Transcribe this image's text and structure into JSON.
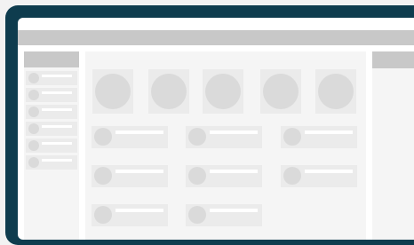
{
  "colors": {
    "device_frame": "#0e3c4e",
    "screen_background": "#ffffff",
    "bar": "#c8c8c8",
    "panel": "#f5f5f5",
    "placeholder": "#ebebeb",
    "placeholder_shape": "#dadada"
  },
  "sidebar": {
    "items": [
      {
        "icon": "circle-placeholder-icon"
      },
      {
        "icon": "circle-placeholder-icon"
      },
      {
        "icon": "circle-placeholder-icon"
      },
      {
        "icon": "circle-placeholder-icon"
      },
      {
        "icon": "circle-placeholder-icon"
      },
      {
        "icon": "circle-placeholder-icon"
      }
    ]
  },
  "main": {
    "avatars": [
      {
        "icon": "avatar-placeholder-icon"
      },
      {
        "icon": "avatar-placeholder-icon"
      },
      {
        "icon": "avatar-placeholder-icon"
      },
      {
        "icon": "avatar-placeholder-icon"
      },
      {
        "icon": "avatar-placeholder-icon"
      }
    ],
    "cards": [
      {
        "icon": "circle-placeholder-icon"
      },
      {
        "icon": "circle-placeholder-icon"
      },
      {
        "icon": "circle-placeholder-icon"
      },
      {
        "icon": "circle-placeholder-icon"
      },
      {
        "icon": "circle-placeholder-icon"
      },
      {
        "icon": "circle-placeholder-icon"
      },
      {
        "icon": "circle-placeholder-icon"
      },
      {
        "icon": "circle-placeholder-icon"
      }
    ]
  }
}
